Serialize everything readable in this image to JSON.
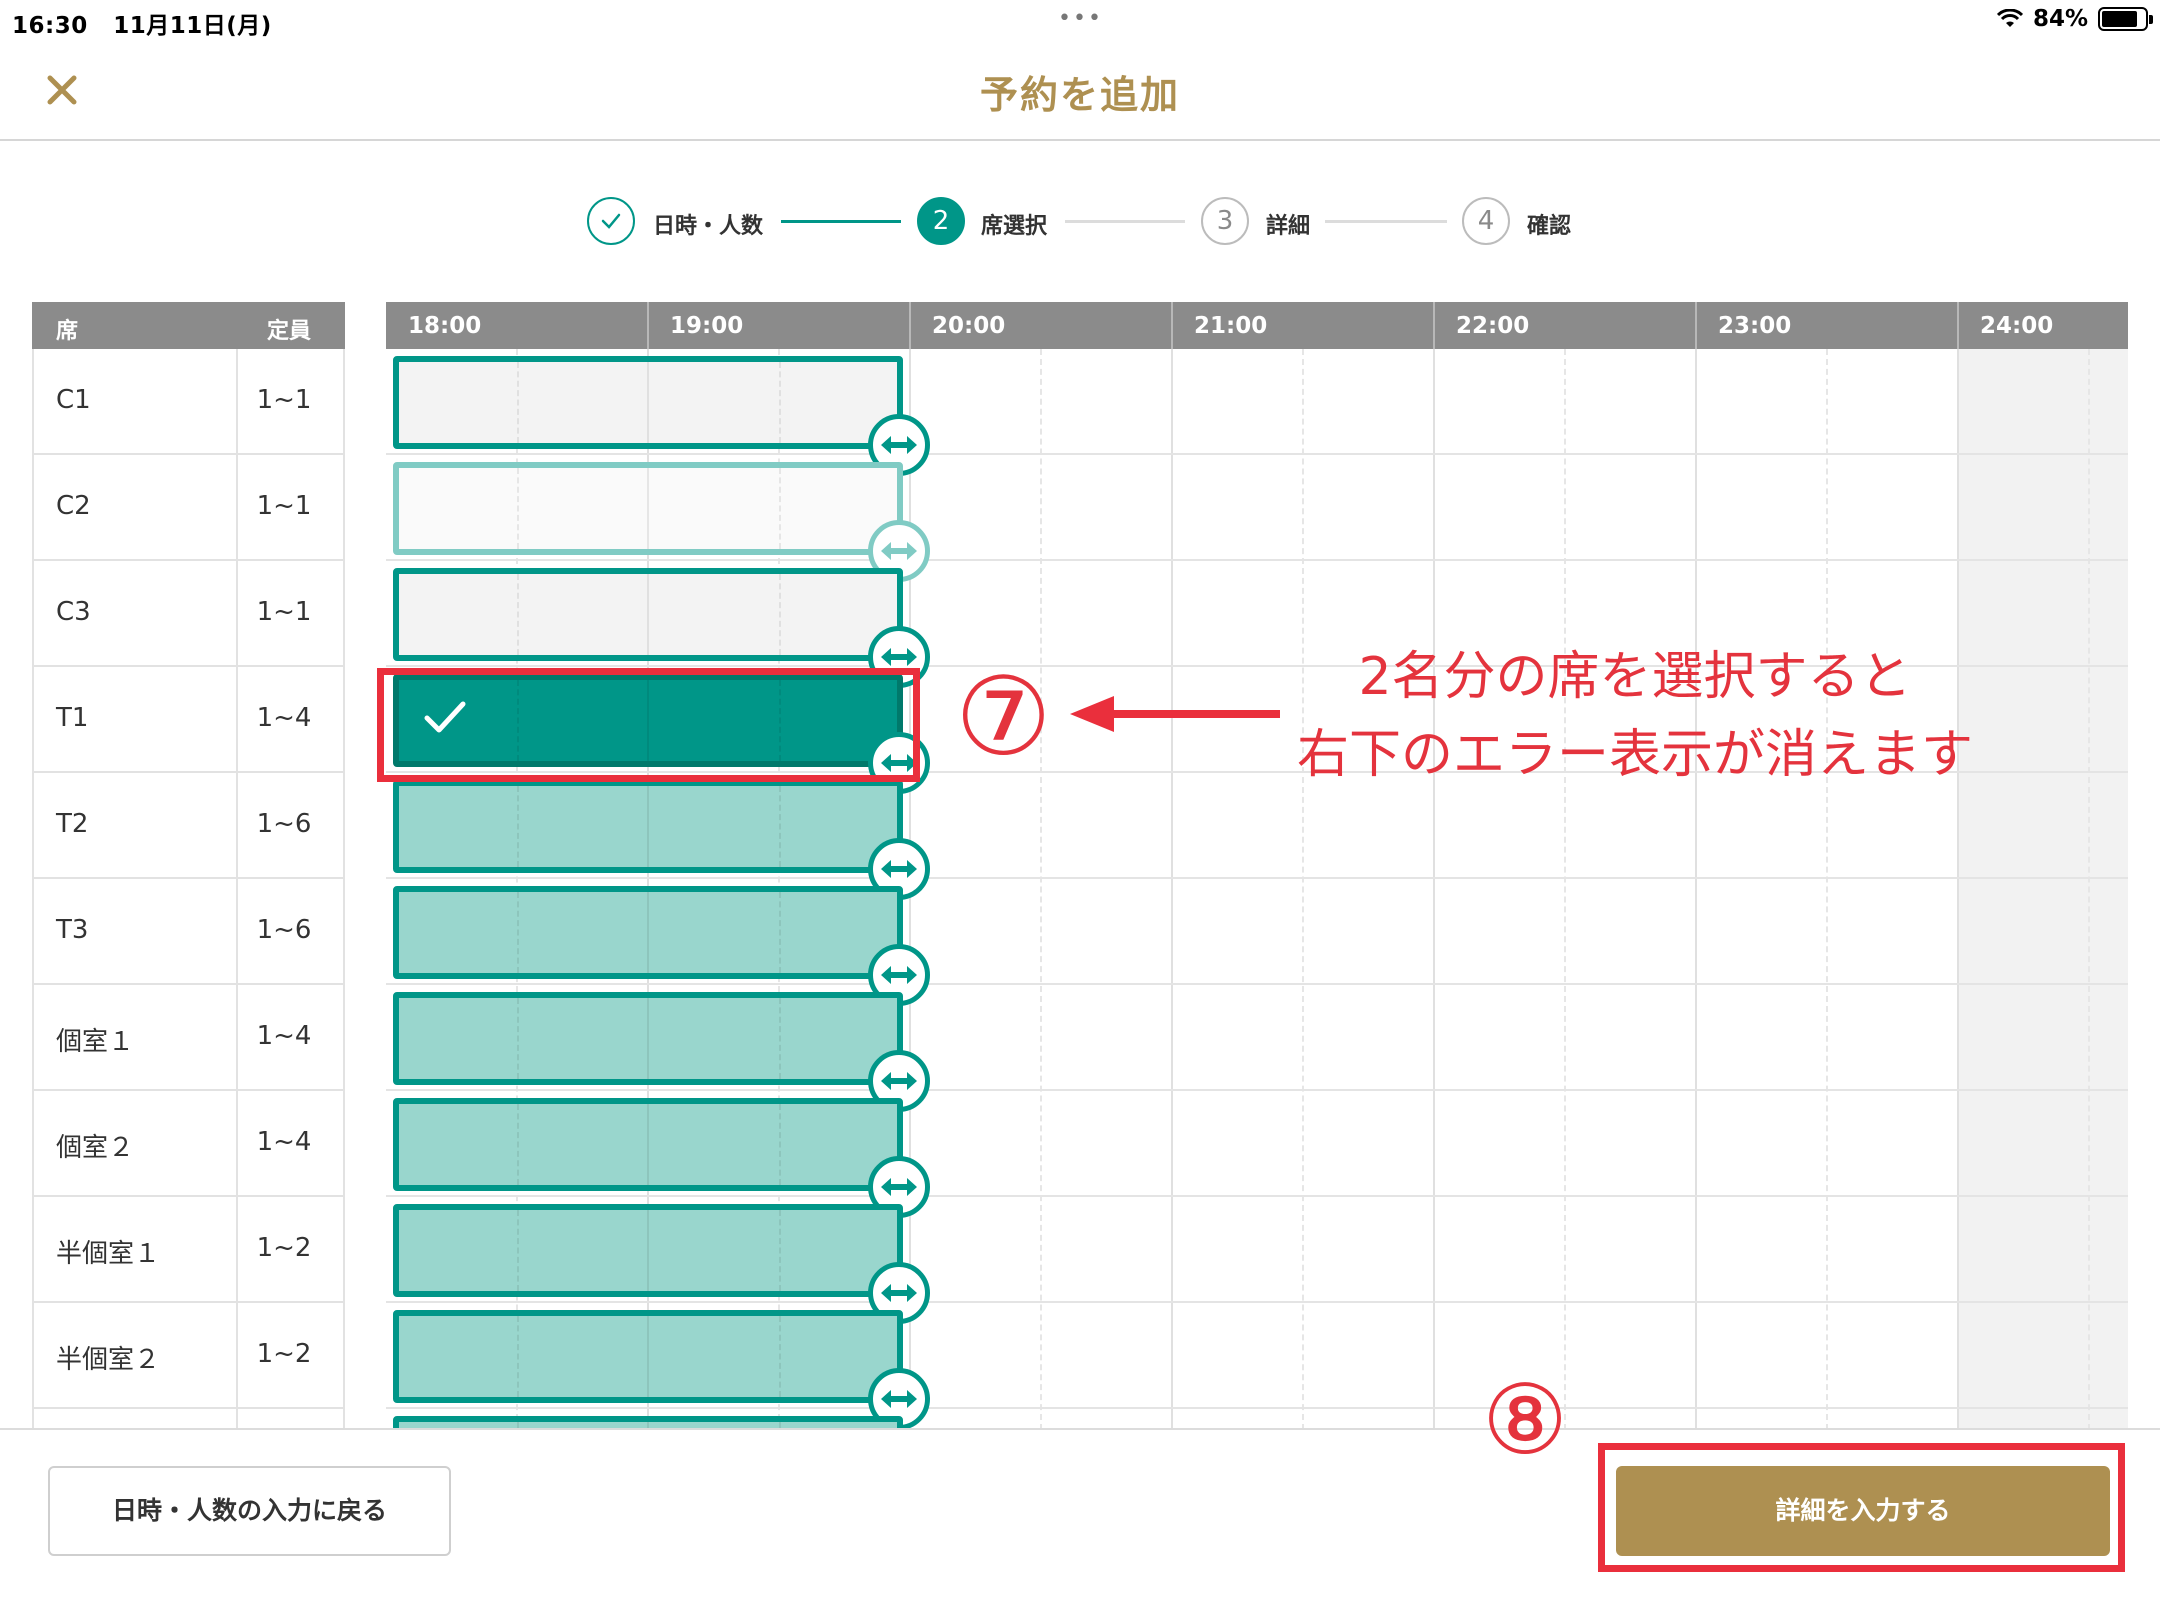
{
  "status_bar": {
    "time": "16:30",
    "date": "11月11日(月)",
    "battery": "84%",
    "dots": "•••"
  },
  "header": {
    "title": "予約を追加",
    "close_icon": "close-icon"
  },
  "stepper": {
    "steps": [
      {
        "number": "✓",
        "label": "日時・人数",
        "state": "done"
      },
      {
        "number": "2",
        "label": "席選択",
        "state": "active"
      },
      {
        "number": "3",
        "label": "詳細",
        "state": "pending"
      },
      {
        "number": "4",
        "label": "確認",
        "state": "pending"
      }
    ]
  },
  "seat_table": {
    "headers": {
      "seat": "席",
      "capacity": "定員"
    },
    "rows": [
      {
        "name": "C1",
        "capacity": "1~1",
        "state": "light"
      },
      {
        "name": "C2",
        "capacity": "1~1",
        "state": "disabled"
      },
      {
        "name": "C3",
        "capacity": "1~1",
        "state": "light"
      },
      {
        "name": "T1",
        "capacity": "1~4",
        "state": "selected"
      },
      {
        "name": "T2",
        "capacity": "1~6",
        "state": "tinted"
      },
      {
        "name": "T3",
        "capacity": "1~6",
        "state": "tinted"
      },
      {
        "name": "個室１",
        "capacity": "1~4",
        "state": "tinted"
      },
      {
        "name": "個室２",
        "capacity": "1~4",
        "state": "tinted"
      },
      {
        "name": "半個室１",
        "capacity": "1~2",
        "state": "tinted"
      },
      {
        "name": "半個室２",
        "capacity": "1~2",
        "state": "tinted"
      },
      {
        "name": "",
        "capacity": "",
        "state": "tinted"
      }
    ]
  },
  "timeline": {
    "hours": [
      "18:00",
      "19:00",
      "20:00",
      "21:00",
      "22:00",
      "23:00",
      "24:00"
    ],
    "reservation_start": "18:00",
    "reservation_end": "20:00"
  },
  "annotations": {
    "step7_number": "⑦",
    "step7_line1": "2名分の席を選択すると",
    "step7_line2": "右下のエラー表示が消えます",
    "step8_number": "⑧",
    "color": "#e4333d"
  },
  "footer": {
    "back_label": "日時・人数の入力に戻る",
    "next_label": "詳細を入力する"
  },
  "colors": {
    "accent_teal": "#009688",
    "gold": "#ae9051",
    "header_gray": "#8b8b8b"
  }
}
